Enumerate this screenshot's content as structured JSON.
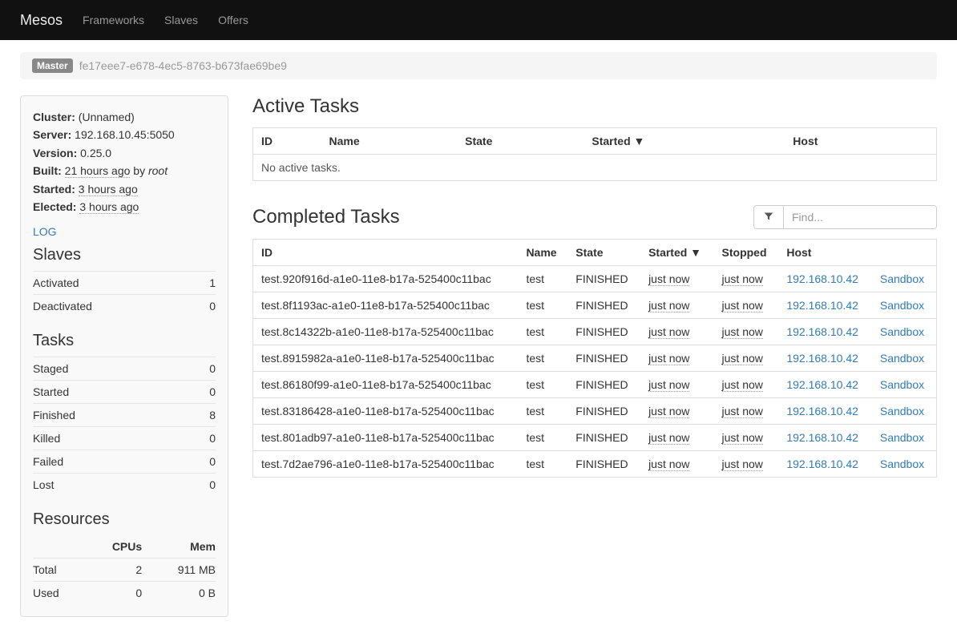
{
  "nav": {
    "brand": "Mesos",
    "links": [
      "Frameworks",
      "Slaves",
      "Offers"
    ]
  },
  "breadcrumb": {
    "badge": "Master",
    "id": "fe17eee7-e678-4ec5-8763-b673fae69be9"
  },
  "sidebar": {
    "cluster_label": "Cluster:",
    "cluster_value": "(Unnamed)",
    "server_label": "Server:",
    "server_value": "192.168.10.45:5050",
    "version_label": "Version:",
    "version_value": "0.25.0",
    "built_label": "Built:",
    "built_time": "21 hours ago",
    "built_by_word": "by",
    "built_by": "root",
    "started_label": "Started:",
    "started_value": "3 hours ago",
    "elected_label": "Elected:",
    "elected_value": "3 hours ago",
    "log": "LOG",
    "slaves_title": "Slaves",
    "slaves": [
      {
        "label": "Activated",
        "value": "1"
      },
      {
        "label": "Deactivated",
        "value": "0"
      }
    ],
    "tasks_title": "Tasks",
    "tasks": [
      {
        "label": "Staged",
        "value": "0"
      },
      {
        "label": "Started",
        "value": "0"
      },
      {
        "label": "Finished",
        "value": "8"
      },
      {
        "label": "Killed",
        "value": "0"
      },
      {
        "label": "Failed",
        "value": "0"
      },
      {
        "label": "Lost",
        "value": "0"
      }
    ],
    "resources_title": "Resources",
    "res_headers": {
      "cpus": "CPUs",
      "mem": "Mem"
    },
    "resources": [
      {
        "label": "Total",
        "cpus": "2",
        "mem": "911 MB"
      },
      {
        "label": "Used",
        "cpus": "0",
        "mem": "0 B"
      }
    ]
  },
  "active": {
    "title": "Active Tasks",
    "headers": {
      "id": "ID",
      "name": "Name",
      "state": "State",
      "started": "Started ▼",
      "host": "Host"
    },
    "empty": "No active tasks."
  },
  "completed": {
    "title": "Completed Tasks",
    "find_placeholder": "Find...",
    "headers": {
      "id": "ID",
      "name": "Name",
      "state": "State",
      "started": "Started ▼",
      "stopped": "Stopped",
      "host": "Host"
    },
    "sandbox_label": "Sandbox",
    "rows": [
      {
        "id": "test.920f916d-a1e0-11e8-b17a-525400c11bac",
        "name": "test",
        "state": "FINISHED",
        "started": "just now",
        "stopped": "just now",
        "host": "192.168.10.42"
      },
      {
        "id": "test.8f1193ac-a1e0-11e8-b17a-525400c11bac",
        "name": "test",
        "state": "FINISHED",
        "started": "just now",
        "stopped": "just now",
        "host": "192.168.10.42"
      },
      {
        "id": "test.8c14322b-a1e0-11e8-b17a-525400c11bac",
        "name": "test",
        "state": "FINISHED",
        "started": "just now",
        "stopped": "just now",
        "host": "192.168.10.42"
      },
      {
        "id": "test.8915982a-a1e0-11e8-b17a-525400c11bac",
        "name": "test",
        "state": "FINISHED",
        "started": "just now",
        "stopped": "just now",
        "host": "192.168.10.42"
      },
      {
        "id": "test.86180f99-a1e0-11e8-b17a-525400c11bac",
        "name": "test",
        "state": "FINISHED",
        "started": "just now",
        "stopped": "just now",
        "host": "192.168.10.42"
      },
      {
        "id": "test.83186428-a1e0-11e8-b17a-525400c11bac",
        "name": "test",
        "state": "FINISHED",
        "started": "just now",
        "stopped": "just now",
        "host": "192.168.10.42"
      },
      {
        "id": "test.801adb97-a1e0-11e8-b17a-525400c11bac",
        "name": "test",
        "state": "FINISHED",
        "started": "just now",
        "stopped": "just now",
        "host": "192.168.10.42"
      },
      {
        "id": "test.7d2ae796-a1e0-11e8-b17a-525400c11bac",
        "name": "test",
        "state": "FINISHED",
        "started": "just now",
        "stopped": "just now",
        "host": "192.168.10.42"
      }
    ]
  }
}
